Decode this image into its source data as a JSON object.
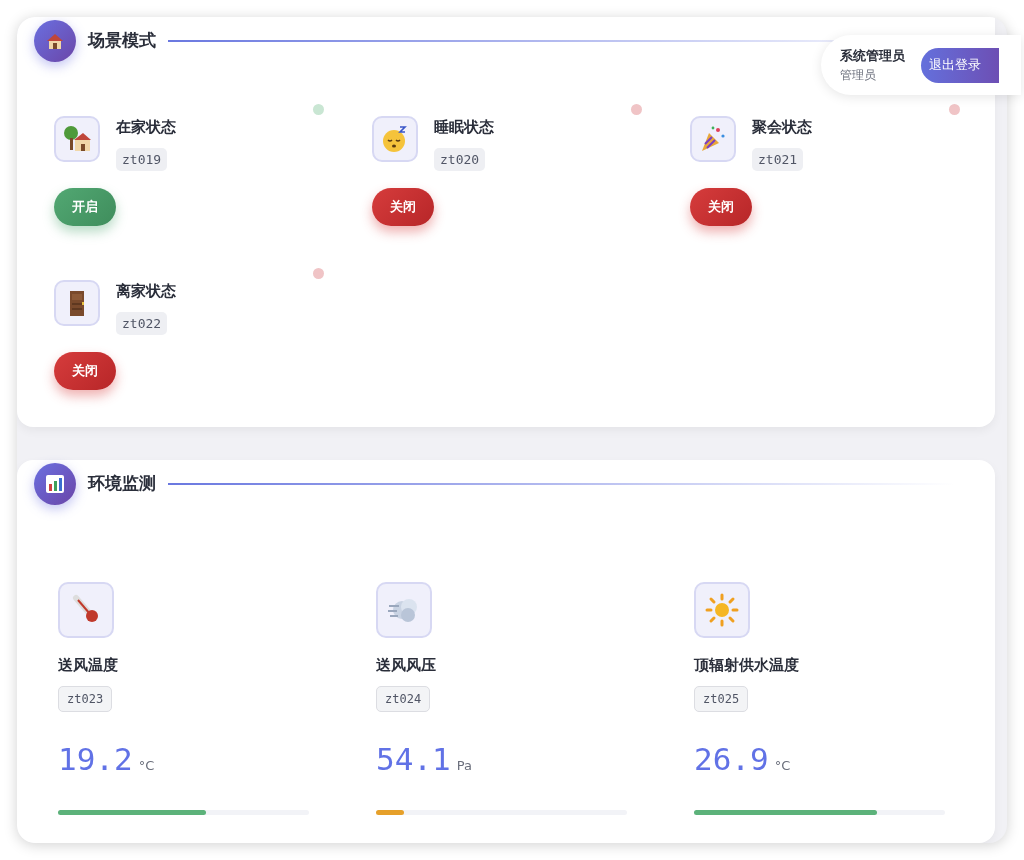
{
  "user": {
    "name": "系统管理员",
    "role": "管理员",
    "logout": "退出登录"
  },
  "scenes": {
    "title": "场景模式",
    "items": [
      {
        "kind": "home",
        "name": "在家状态",
        "code": "zt019",
        "on": true,
        "button": "开启"
      },
      {
        "kind": "sleep",
        "name": "睡眠状态",
        "code": "zt020",
        "on": false,
        "button": "关闭"
      },
      {
        "kind": "party",
        "name": "聚会状态",
        "code": "zt021",
        "on": false,
        "button": "关闭"
      },
      {
        "kind": "door",
        "name": "离家状态",
        "code": "zt022",
        "on": false,
        "button": "关闭"
      }
    ]
  },
  "environment": {
    "title": "环境监测",
    "items": [
      {
        "kind": "thermometer",
        "name": "送风温度",
        "code": "zt023",
        "value": "19.2",
        "unit": "°C",
        "level": 0.59,
        "color": "#5cb27a"
      },
      {
        "kind": "wind",
        "name": "送风风压",
        "code": "zt024",
        "value": "54.1",
        "unit": "Pa",
        "level": 0.11,
        "color": "#e6a02a"
      },
      {
        "kind": "sun",
        "name": "顶辐射供水温度",
        "code": "zt025",
        "value": "26.9",
        "unit": "°C",
        "level": 0.73,
        "color": "#5cb27a"
      }
    ]
  }
}
